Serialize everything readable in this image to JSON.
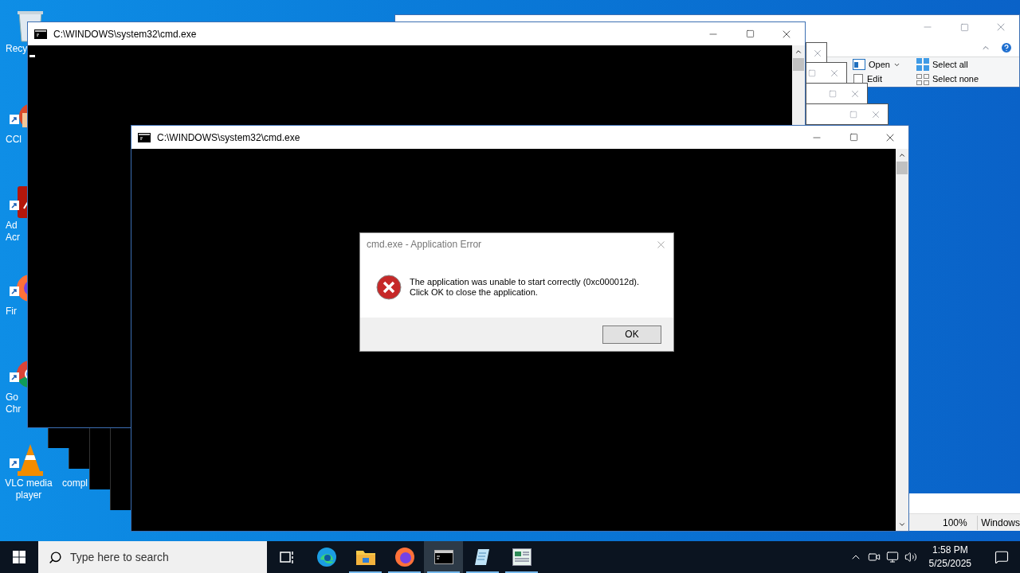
{
  "desktop_icons": [
    {
      "kind": "recycle-bin",
      "label_lines": [
        "Recy"
      ],
      "shortcut": false
    },
    {
      "kind": "ccleaner",
      "label_lines": [
        "CCl"
      ],
      "shortcut": true
    },
    {
      "kind": "acrobat",
      "label_lines": [
        "Ad",
        "Acr"
      ],
      "shortcut": true
    },
    {
      "kind": "firefox",
      "label_lines": [
        "Fir"
      ],
      "shortcut": true
    },
    {
      "kind": "chrome",
      "label_lines": [
        "Go",
        "Chr"
      ],
      "shortcut": true
    },
    {
      "kind": "vlc",
      "label_lines": [
        "VLC media",
        "player"
      ],
      "shortcut": true
    }
  ],
  "covered_icon": {
    "label": "compl"
  },
  "explorer": {
    "ribbon": [
      {
        "kind": "open",
        "label": "Open",
        "dropdown": true
      },
      {
        "kind": "select-all",
        "label": "Select all",
        "dropdown": false
      },
      {
        "kind": "edit",
        "label": "Edit",
        "dropdown": false
      },
      {
        "kind": "select-none",
        "label": "Select none",
        "dropdown": false
      }
    ],
    "status_bar": {
      "zoom": "100%",
      "line_ending": "Windows"
    }
  },
  "cmd_windows": [
    {
      "title": "C:\\WINDOWS\\system32\\cmd.exe",
      "cursor": true
    },
    {
      "title": "C:\\WINDOWS\\system32\\cmd.exe",
      "cursor": false
    }
  ],
  "dialog": {
    "title": "cmd.exe - Application Error",
    "message_lines": [
      "The application was unable to start correctly (0xc000012d).",
      "Click OK to close the application."
    ],
    "button": "OK"
  },
  "taskbar": {
    "search": {
      "placeholder": "Type here to search"
    },
    "apps": [
      {
        "kind": "task-view",
        "selected": false,
        "running": false
      },
      {
        "kind": "edge",
        "selected": false,
        "running": false
      },
      {
        "kind": "explorer",
        "selected": false,
        "running": true
      },
      {
        "kind": "firefox",
        "selected": false,
        "running": true
      },
      {
        "kind": "cmd",
        "selected": true,
        "running": true
      },
      {
        "kind": "notepad",
        "selected": false,
        "running": true
      },
      {
        "kind": "app",
        "selected": false,
        "running": true
      }
    ],
    "time": "1:58 PM",
    "date": "5/25/2025"
  }
}
